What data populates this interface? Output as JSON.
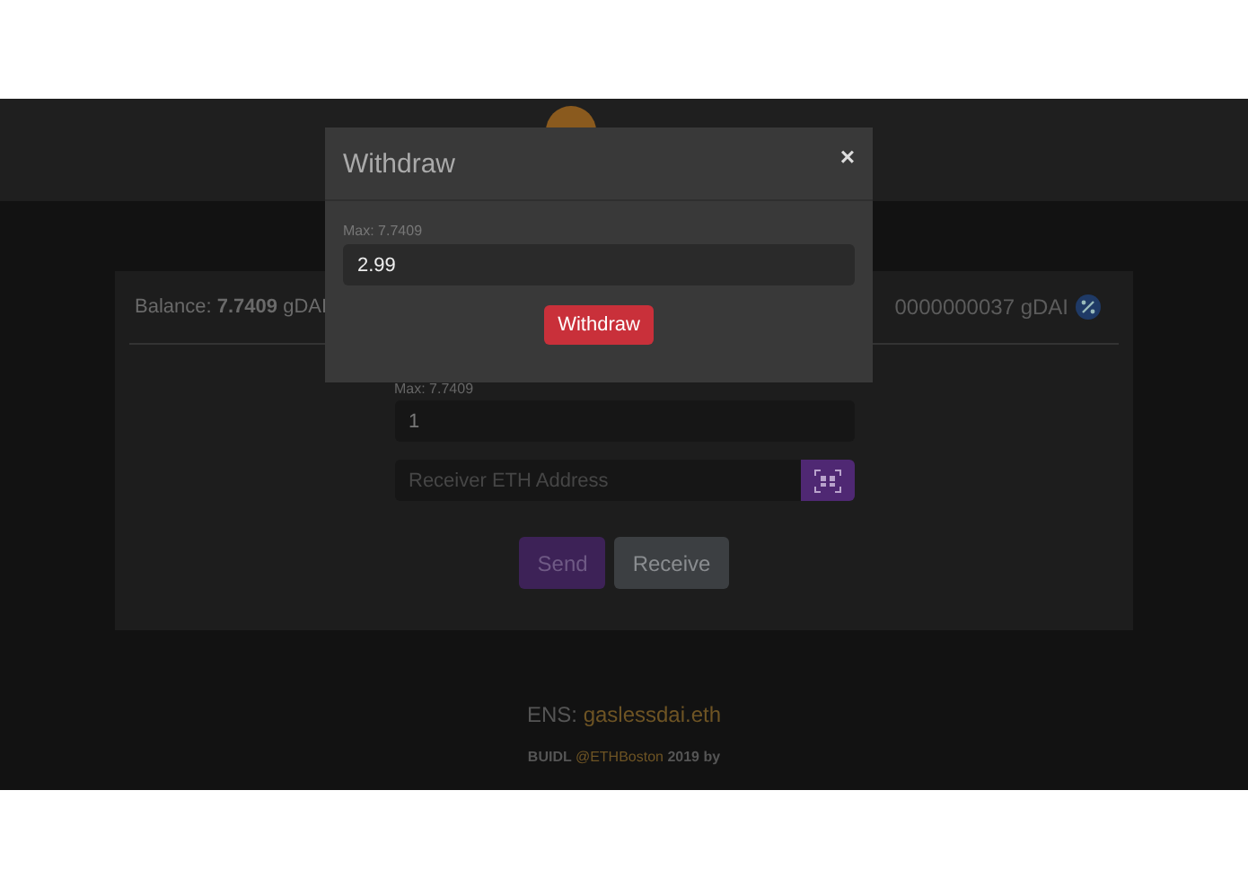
{
  "balance": {
    "text": "Balance: **7.7409** gDAI",
    "right_text": "0000000037 gDAI"
  },
  "form": {
    "max_label": "Max: 7.7409",
    "amount_value": "1",
    "address_placeholder": "Receiver ETH Address",
    "buttons": [
      {
        "label": "Send",
        "kind": "primary"
      },
      {
        "label": "Receive",
        "kind": "secondary"
      }
    ]
  },
  "footer": {
    "ens_label": "ENS:",
    "ens_name": "gaslessdai.eth",
    "credit_before": "BUIDL",
    "credit_link": "@ETHBoston",
    "credit_after": "2019 by"
  },
  "modal": {
    "title": "Withdraw",
    "close": "×",
    "max_label": "Max: 7.7409",
    "value": "2.99",
    "button": "Withdraw"
  }
}
